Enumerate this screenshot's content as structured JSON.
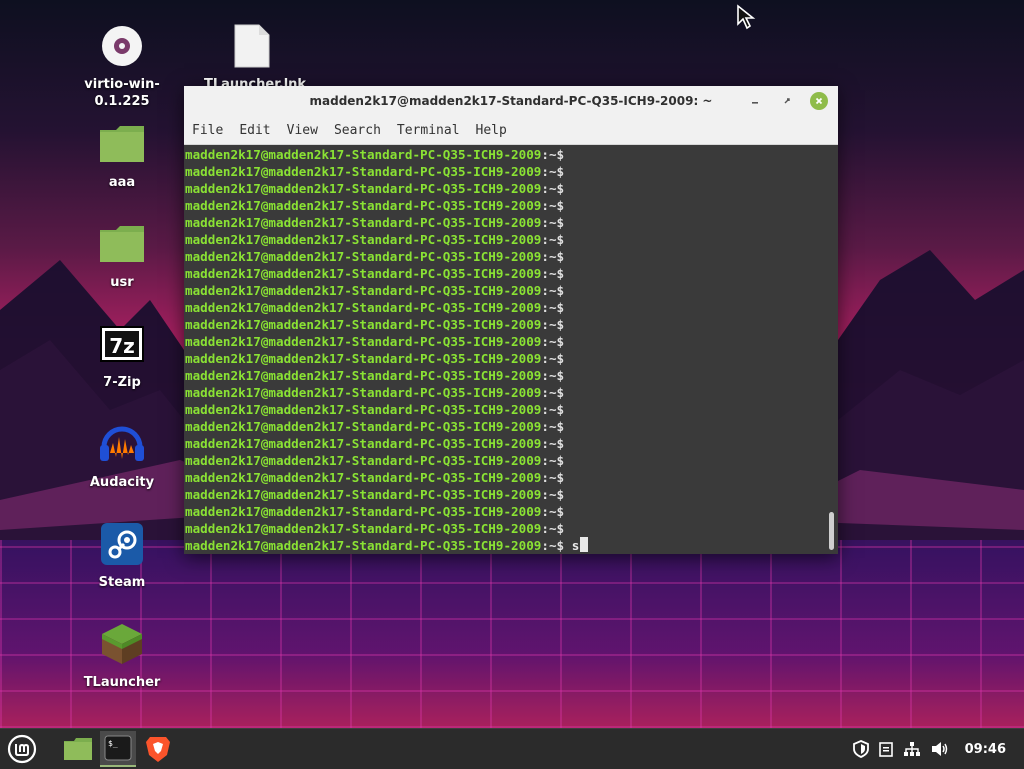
{
  "desktop": {
    "icons": [
      {
        "label": "virtio-win-\n0.1.225",
        "icon": "disc-icon"
      },
      {
        "label": "TLauncher.lnk",
        "icon": "file-icon"
      },
      {
        "label": "aaa",
        "icon": "folder-icon"
      },
      {
        "label": "usr",
        "icon": "folder-icon"
      },
      {
        "label": "7-Zip",
        "icon": "7zip-icon"
      },
      {
        "label": "Audacity",
        "icon": "audacity-icon"
      },
      {
        "label": "Steam",
        "icon": "steam-icon"
      },
      {
        "label": "TLauncher",
        "icon": "minecraft-grass-icon"
      }
    ]
  },
  "terminal": {
    "title": "madden2k17@madden2k17-Standard-PC-Q35-ICH9-2009: ~",
    "menu": [
      "File",
      "Edit",
      "View",
      "Search",
      "Terminal",
      "Help"
    ],
    "prompt_user_host": "madden2k17@madden2k17-Standard-PC-Q35-ICH9-2009",
    "prompt_suffix": ":~$",
    "line_count": 24,
    "current_input": "s"
  },
  "taskbar": {
    "clock": "09:46",
    "apps": [
      "mint-menu-icon",
      "files-icon",
      "terminal-icon",
      "brave-icon"
    ],
    "tray": [
      "shield-icon",
      "clipboard-icon",
      "network-icon",
      "volume-icon"
    ]
  },
  "colors": {
    "prompt_green": "#8ae234",
    "terminal_bg": "#3a3a3a",
    "titlebar_bg": "#f1f1f1",
    "taskbar_bg": "#2b2b2b",
    "mint_green": "#8fbc4a"
  }
}
